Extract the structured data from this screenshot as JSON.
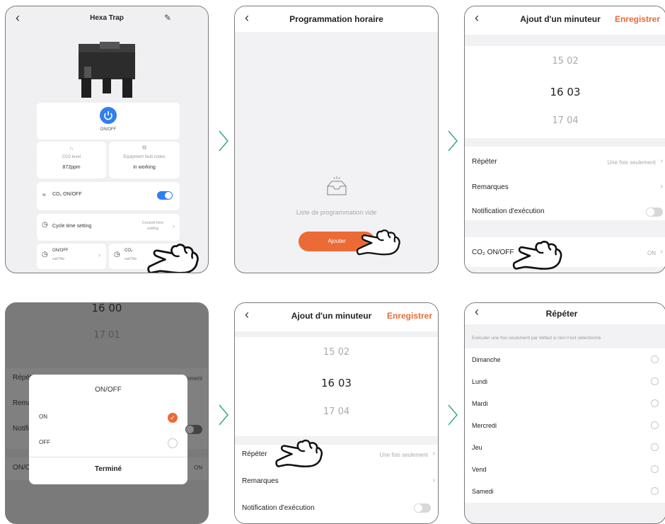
{
  "colors": {
    "accent": "#ec6a35",
    "toggle_on": "#2f7ff0",
    "power": "#2f7ff0"
  },
  "panel1": {
    "title": "Hexa Trap",
    "power_label": "ON/OFF",
    "co2_level_label": "CO2 level",
    "co2_level_value": "872ppm",
    "equipment_label": "Equipment fault codes",
    "equipment_value": "in working",
    "co2_toggle_label": "CO₂ ON/OFF",
    "cycle_label": "Cycle time setting",
    "cycle_value": "Consult time setting",
    "tile1_title": "ON/OFF",
    "tile1_sub": "subTitle",
    "tile2_title": "CO₂",
    "tile2_sub": "subTitle"
  },
  "panel2": {
    "title": "Programmation horaire",
    "empty_text": "Liste de programmation vide",
    "add_button": "Ajouter"
  },
  "panel3": {
    "title": "Ajout d'un minuteur",
    "save": "Enregistrer",
    "times": [
      "15 02",
      "16 03",
      "17 04"
    ],
    "repeat_label": "Répéter",
    "repeat_value": "Une fois seulement",
    "notes_label": "Remarques",
    "notify_label": "Notification d'exécution",
    "co2_label": "CO₂ ON/OFF",
    "co2_value": "ON"
  },
  "panel4": {
    "bg_times": [
      "16 00",
      "17 01"
    ],
    "bg_rows": [
      "Répéter",
      "Remarques",
      "Notification d'exécution",
      "ON/OFF"
    ],
    "bg_repeat_value": "Une fois seulement",
    "bg_co2_value": "ON",
    "dialog_title": "ON/OFF",
    "opt_on": "ON",
    "opt_off": "OFF",
    "done": "Terminé"
  },
  "panel5": {
    "title": "Ajout d'un minuteur",
    "save": "Enregistrer",
    "times": [
      "15 02",
      "16 03",
      "17 04"
    ],
    "repeat_label": "Répéter",
    "repeat_value": "Une fois seulement",
    "notes_label": "Remarques",
    "notify_label": "Notification d'exécution"
  },
  "panel6": {
    "title": "Répéter",
    "hint": "Exécuter une fois seulement par défaut si rien n'est sélectionné",
    "days": [
      "Dimanche",
      "Lundi",
      "Mardi",
      "Mercredi",
      "Jeu",
      "Vend",
      "Samedi"
    ]
  }
}
